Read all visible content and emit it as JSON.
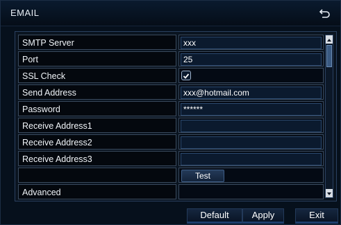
{
  "window": {
    "title": "EMAIL"
  },
  "rows": [
    {
      "label": "SMTP Server",
      "value": "xxx"
    },
    {
      "label": "Port",
      "value": "25"
    },
    {
      "label": "SSL Check",
      "checked": true
    },
    {
      "label": "Send Address",
      "value": "xxx@hotmail.com"
    },
    {
      "label": "Password",
      "value": "******"
    },
    {
      "label": "Receive Address1",
      "value": ""
    },
    {
      "label": "Receive Address2",
      "value": ""
    },
    {
      "label": "Receive Address3",
      "value": ""
    },
    {
      "label": "",
      "button": "Test"
    },
    {
      "label": "Advanced",
      "value": ""
    }
  ],
  "footer": {
    "default_label": "Default",
    "apply_label": "Apply",
    "exit_label": "Exit"
  },
  "icons": {
    "back": "back-arrow-icon",
    "check": "checkmark-icon",
    "scroll_up": "triangle-up-icon",
    "scroll_down": "triangle-down-icon"
  }
}
